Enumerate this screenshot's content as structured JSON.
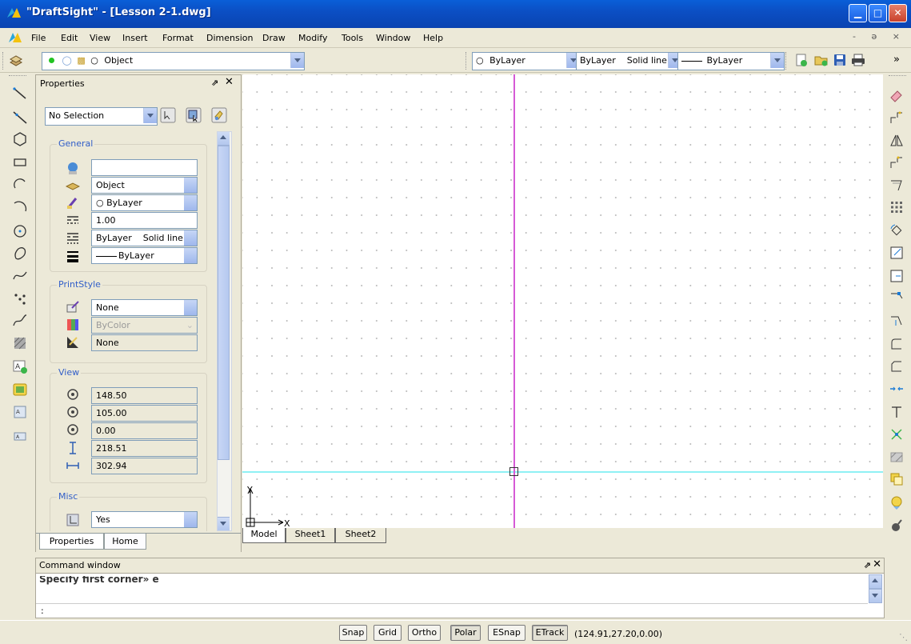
{
  "window": {
    "title": "\"DraftSight\" - [Lesson 2-1.dwg]",
    "controls": [
      "minimize",
      "maximize",
      "close"
    ]
  },
  "menu": {
    "items": [
      "File",
      "Edit",
      "View",
      "Insert",
      "Format",
      "Dimension",
      "Draw",
      "Modify",
      "Tools",
      "Window",
      "Help"
    ],
    "mdi_controls": "- ə ×"
  },
  "toolbar": {
    "layer_combo": "Object",
    "color_combo": "ByLayer",
    "linestyle_combo": "ByLayer    Solid line",
    "lineweight_combo": "ByLayer",
    "overflow": "»"
  },
  "properties": {
    "title": "Properties",
    "selection": "No Selection",
    "groups": {
      "general": {
        "title": "General",
        "fields": [
          "",
          "Object",
          "ByLayer",
          "1.00",
          "ByLayer    Solid line",
          "ByLayer"
        ]
      },
      "printstyle": {
        "title": "PrintStyle",
        "fields": [
          "None",
          "ByColor",
          "None"
        ]
      },
      "view": {
        "title": "View",
        "fields": [
          "148.50",
          "105.00",
          "0.00",
          "218.51",
          "302.94"
        ]
      },
      "misc": {
        "title": "Misc",
        "fields": [
          "Yes"
        ]
      }
    },
    "tabs": [
      "Properties",
      "Home"
    ]
  },
  "canvas": {
    "axis_y": "Y",
    "axis_x": "X",
    "tabs": [
      "Model",
      "Sheet1",
      "Sheet2"
    ],
    "colors": {
      "horizontal_line": "#8ff1f4",
      "vertical_line": "#d65ad6"
    }
  },
  "command": {
    "title": "Command window",
    "history": "Specify first corner» e",
    "prompt": ":"
  },
  "status": {
    "buttons": [
      "Snap",
      "Grid",
      "Ortho",
      "Polar",
      "ESnap",
      "ETrack"
    ],
    "coordinates": "(124.91,27.20,0.00)"
  }
}
